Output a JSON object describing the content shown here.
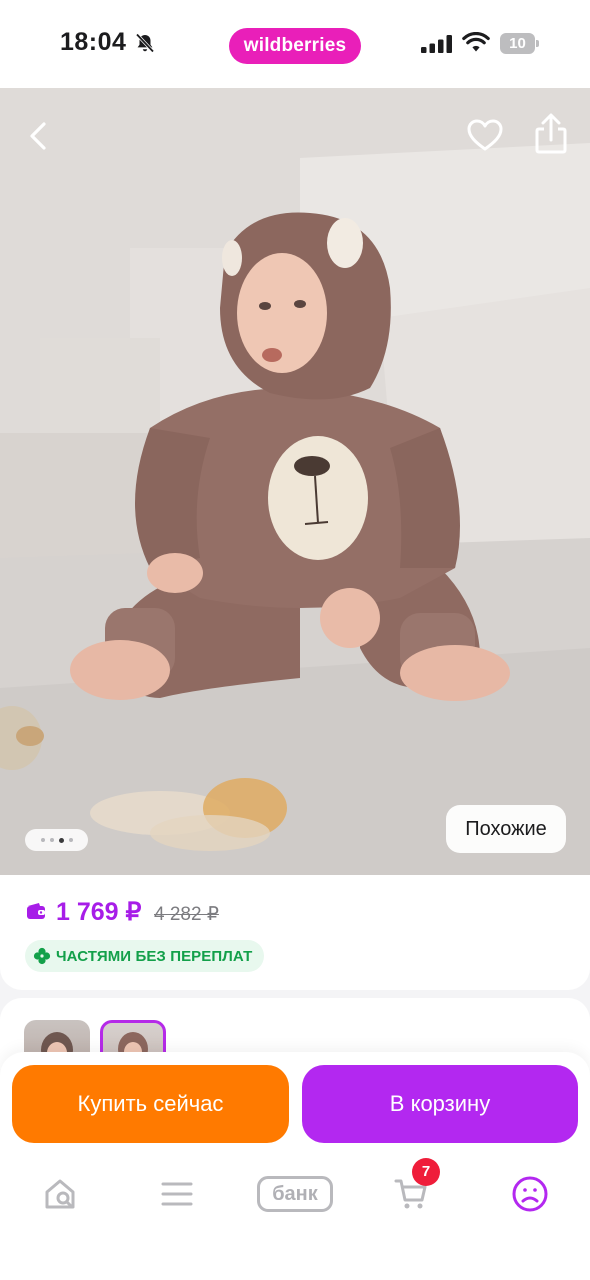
{
  "status_bar": {
    "time": "18:04",
    "brand": "wildberries",
    "battery": "10"
  },
  "photo": {
    "similar_label": "Похожие",
    "gallery_dots": 4
  },
  "price": {
    "current": "1 769 ₽",
    "old": "4 282 ₽",
    "installment": "ЧАСТЯМИ БЕЗ ПЕРЕПЛАТ"
  },
  "actions": {
    "buy_now": "Купить сейчас",
    "add_to_cart": "В корзину"
  },
  "tab_bar": {
    "bank_label": "банк",
    "cart_count": "7"
  },
  "colors": {
    "brand_pink": "#e91fb9",
    "price_purple": "#a71de8",
    "buy_orange": "#ff7a00",
    "cart_purple": "#b328f0",
    "installment_green": "#13a04a",
    "badge_red": "#ef1d3a"
  }
}
